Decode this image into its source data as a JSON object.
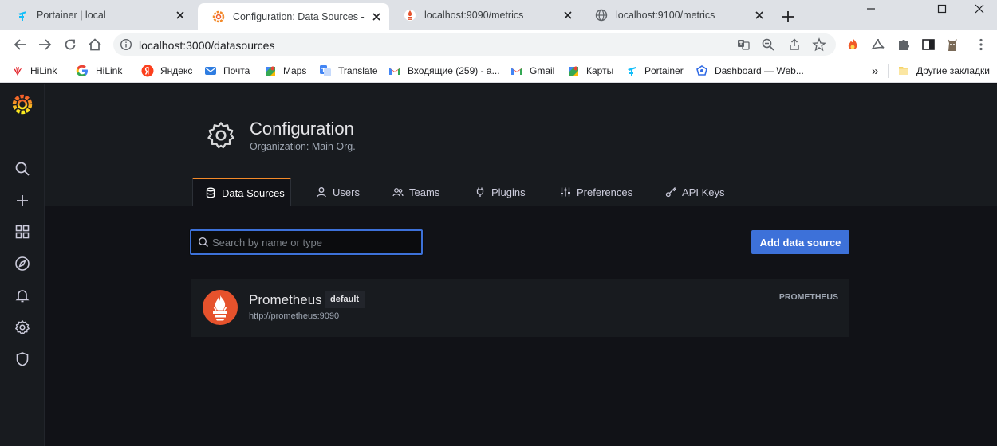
{
  "browser": {
    "tabs": [
      {
        "title": "Portainer | local",
        "icon": "portainer-icon",
        "active": false
      },
      {
        "title": "Configuration: Data Sources - Gr",
        "icon": "grafana-icon",
        "active": true
      },
      {
        "title": "localhost:9090/metrics",
        "icon": "prometheus-icon",
        "active": false
      },
      {
        "title": "localhost:9100/metrics",
        "icon": "globe-icon",
        "active": false
      }
    ],
    "new_tab_symbol": "+",
    "address": "localhost:3000/datasources"
  },
  "bookmarks": [
    {
      "label": "HiLink",
      "icon": "huawei-icon"
    },
    {
      "label": "HiLink",
      "icon": "google-icon"
    },
    {
      "label": "Яндекс",
      "icon": "yandex-icon"
    },
    {
      "label": "Почта",
      "icon": "mail-icon"
    },
    {
      "label": "Maps",
      "icon": "maps-icon"
    },
    {
      "label": "Translate",
      "icon": "translate-icon"
    },
    {
      "label": "Входящие (259) - a...",
      "icon": "gmail-icon"
    },
    {
      "label": "Gmail",
      "icon": "gmail-icon"
    },
    {
      "label": "Карты",
      "icon": "maps-icon"
    },
    {
      "label": "Portainer",
      "icon": "portainer-icon"
    },
    {
      "label": "Dashboard — Web...",
      "icon": "dashboard-icon"
    }
  ],
  "bookmarks_more": "»",
  "bookmarks_other": "Другие закладки",
  "grafana": {
    "header": {
      "title": "Configuration",
      "subtitle": "Organization: Main Org."
    },
    "tabs": [
      {
        "label": "Data Sources",
        "icon": "database-icon",
        "active": true
      },
      {
        "label": "Users",
        "icon": "user-icon",
        "active": false
      },
      {
        "label": "Teams",
        "icon": "users-icon",
        "active": false
      },
      {
        "label": "Plugins",
        "icon": "plug-icon",
        "active": false
      },
      {
        "label": "Preferences",
        "icon": "sliders-icon",
        "active": false
      },
      {
        "label": "API Keys",
        "icon": "key-icon",
        "active": false
      }
    ],
    "search_placeholder": "Search by name or type",
    "add_button": "Add data source",
    "datasources": [
      {
        "name": "Prometheus",
        "badge": "default",
        "url": "http://prometheus:9090",
        "type": "PROMETHEUS"
      }
    ],
    "colors": {
      "accent": "#3d71d9",
      "active_tab": "#f38a29",
      "prometheus": "#e6522c"
    }
  }
}
